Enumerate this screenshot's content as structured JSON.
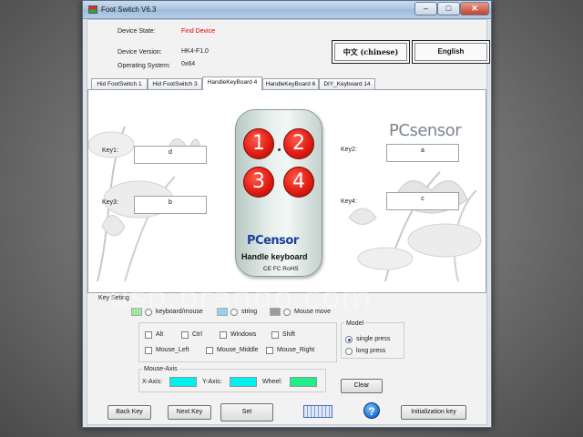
{
  "window": {
    "title": "Foot Switch V6.3",
    "controls": {
      "minimize": "–",
      "maximize": "□",
      "close": "✕"
    }
  },
  "device": {
    "state_label": "Device State:",
    "state_value": "Find Device",
    "version_label": "Device Version:",
    "version_value": "HK4-F1.0",
    "os_label": "Operating System:",
    "os_value": "0x64"
  },
  "language": {
    "chinese": "中文 (chinese)",
    "english": "English"
  },
  "tabs": [
    {
      "label": "Hid FootSwitch 1",
      "active": false
    },
    {
      "label": "Hid FootSwitch 3",
      "active": false
    },
    {
      "label": "HandleKeyBoard 4",
      "active": true
    },
    {
      "label": "HandleKeyBoard 6",
      "active": false
    },
    {
      "label": "DIY_Keyboard 14",
      "active": false
    }
  ],
  "keys": {
    "key1": {
      "label": "Key1:",
      "value": "d"
    },
    "key2": {
      "label": "Key2:",
      "value": "a"
    },
    "key3": {
      "label": "Key3:",
      "value": "b"
    },
    "key4": {
      "label": "Key4:",
      "value": "c"
    }
  },
  "device_image": {
    "buttons": [
      "1",
      "2",
      "3",
      "4"
    ],
    "brand_pc": "PC",
    "brand_rest": "ensor",
    "model": "Handle keyboard",
    "certifications": "CE FC RoHS",
    "logo_pc": "PC",
    "logo_rest": "sensor"
  },
  "key_setting": {
    "title": "Key Seting",
    "modes": [
      {
        "label": "keyboard/mouse",
        "color": "#9fe89f",
        "checked": false
      },
      {
        "label": "string",
        "color": "#8fd3f0",
        "checked": false
      },
      {
        "label": "Mouse move",
        "color": "#9a9a9a",
        "checked": false
      }
    ],
    "modifiers": [
      "Alt",
      "Ctrl",
      "Windows",
      "Shift"
    ],
    "mouse_buttons": [
      "Mouse_Left",
      "Mouse_Middle",
      "Mouse_Right"
    ],
    "mouse_axis": {
      "title": "Mouse-Axis",
      "x_label": "X-Axis:",
      "x_color": "#00f0f0",
      "y_label": "Y-Axis:",
      "y_color": "#00f0f0",
      "wheel_label": "Wheel:",
      "wheel_color": "#22ee88"
    },
    "model": {
      "title": "Model",
      "options": [
        {
          "label": "single press",
          "checked": true
        },
        {
          "label": "long press",
          "checked": false
        }
      ]
    },
    "clear_label": "Clear"
  },
  "footer": {
    "back_key": "Back Key",
    "next_key": "Next Key",
    "set": "Set",
    "help": "?",
    "init_key": "Initialization key"
  },
  "watermark": "usb.brando.com"
}
